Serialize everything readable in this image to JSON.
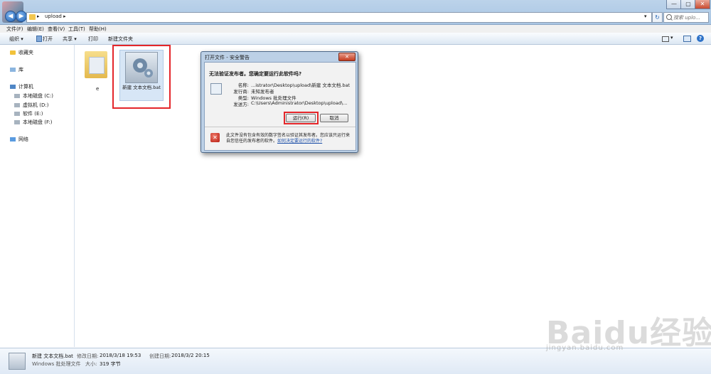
{
  "window": {
    "address_text": "upload  ▸",
    "search_placeholder": "搜索 uplo...",
    "controls": {
      "minimize": "—",
      "maximize": "▢",
      "close": "✕"
    }
  },
  "menubar": [
    "文件(F)",
    "编辑(E)",
    "查看(V)",
    "工具(T)",
    "帮助(H)"
  ],
  "toolbar": {
    "organize": "组织 ▾",
    "open": "打开",
    "share": "共享 ▾",
    "print": "打印",
    "new_folder": "新建文件夹"
  },
  "nav": {
    "favorites": "收藏夹",
    "libraries": "库",
    "computer": "计算机",
    "drives": [
      "本地磁盘 (C:)",
      "虚拟机 (D:)",
      "软件 (E:)",
      "本地磁盘 (F:)"
    ],
    "network": "网络"
  },
  "files": [
    {
      "name": "e",
      "type": "folder"
    },
    {
      "name": "新建 文本文档.bat",
      "type": "batch"
    }
  ],
  "dialog": {
    "title": "打开文件 - 安全警告",
    "heading": "无法验证发布者。您确定要运行此软件吗?",
    "fields": [
      {
        "label": "名称:",
        "value": "...istrator\\Desktop\\upload\\新建 文本文档.bat"
      },
      {
        "label": "发行商:",
        "value": "未知发布者"
      },
      {
        "label": "类型:",
        "value": "Windows 批处理文件"
      },
      {
        "label": "发送方:",
        "value": "C:\\Users\\Administrator\\Desktop\\upload\\..."
      }
    ],
    "run_button": "运行(R)",
    "cancel_button": "取消",
    "warning_text": "此文件没有包含有效的数字签名以验证其发布者。您应该只运行来自您信任的发布者的软件。",
    "warning_link": "如何决定要运行的软件?"
  },
  "status": {
    "filename": "新建 文本文档.bat",
    "file_type": "Windows 批处理文件",
    "modified_label": "修改日期:",
    "modified_value": "2018/3/18 19:53",
    "size_label": "大小:",
    "size_value": "319 字节",
    "created_label": "创建日期:",
    "created_value": "2018/3/2 20:15"
  },
  "watermark": {
    "main": "Baidu经验",
    "sub": "jingyan.baidu.com"
  },
  "colors": {
    "highlight_red": "#e4262a",
    "link_blue": "#1c4fa8",
    "accent_blue": "#1f62b4"
  }
}
